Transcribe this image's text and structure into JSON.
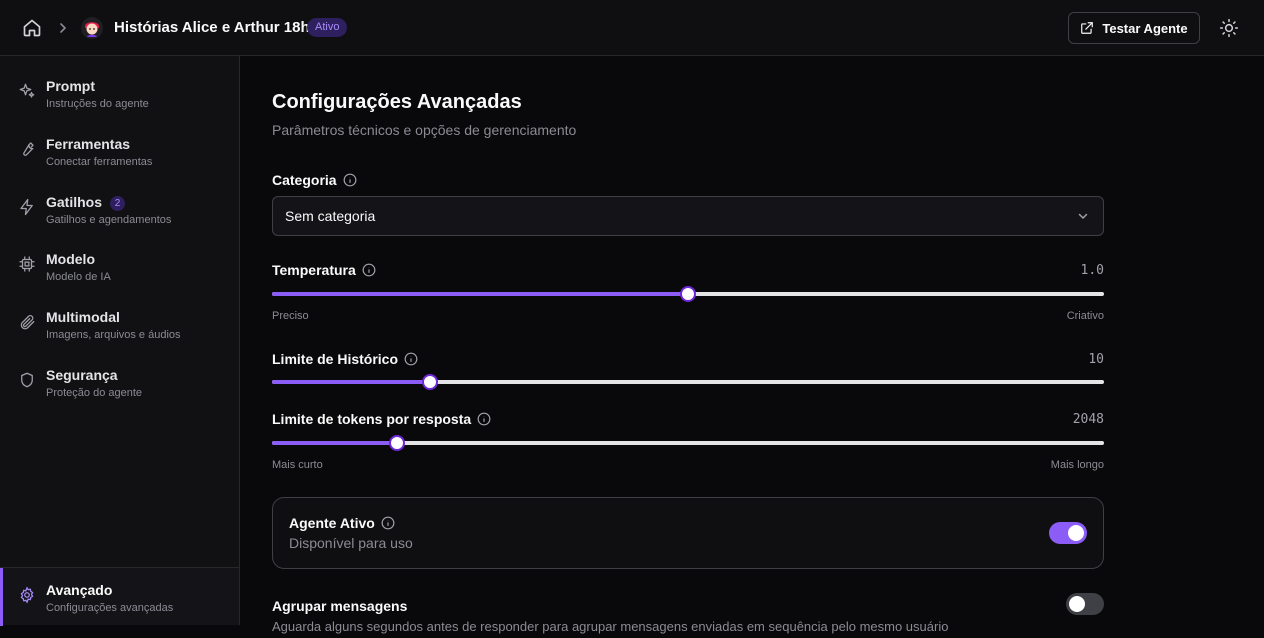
{
  "header": {
    "agent_name": "Histórias Alice e Arthur 18h",
    "status_badge": "Ativo",
    "test_button": "Testar Agente"
  },
  "sidebar": {
    "items": [
      {
        "title": "Prompt",
        "subtitle": "Instruções do agente",
        "icon": "sparkles-icon"
      },
      {
        "title": "Ferramentas",
        "subtitle": "Conectar ferramentas",
        "icon": "wrench-icon"
      },
      {
        "title": "Gatilhos",
        "subtitle": "Gatilhos e agendamentos",
        "icon": "lightning-icon",
        "count": "2"
      },
      {
        "title": "Modelo",
        "subtitle": "Modelo de IA",
        "icon": "cpu-icon"
      },
      {
        "title": "Multimodal",
        "subtitle": "Imagens, arquivos e áudios",
        "icon": "paperclip-icon"
      },
      {
        "title": "Segurança",
        "subtitle": "Proteção do agente",
        "icon": "shield-icon"
      }
    ],
    "active": {
      "title": "Avançado",
      "subtitle": "Configurações avançadas",
      "icon": "gear-icon"
    }
  },
  "main": {
    "title": "Configurações Avançadas",
    "subtitle": "Parâmetros técnicos e opções de gerenciamento",
    "category": {
      "label": "Categoria",
      "value": "Sem categoria"
    },
    "temperature": {
      "label": "Temperatura",
      "value": "1.0",
      "fraction": 0.5,
      "min_label": "Preciso",
      "max_label": "Criativo"
    },
    "history": {
      "label": "Limite de Histórico",
      "value": "10",
      "fraction": 0.19
    },
    "tokens": {
      "label": "Limite de tokens por resposta",
      "value": "2048",
      "fraction": 0.15,
      "min_label": "Mais curto",
      "max_label": "Mais longo"
    },
    "agent_active": {
      "label": "Agente Ativo",
      "sublabel": "Disponível para uso",
      "on": true
    },
    "group_messages": {
      "label": "Agrupar mensagens",
      "sublabel": "Aguarda alguns segundos antes de responder para agrupar mensagens enviadas em sequência pelo mesmo usuário",
      "on": false
    }
  },
  "colors": {
    "accent": "#8b5cf6",
    "background": "#09090b",
    "sidebar": "#111114"
  }
}
